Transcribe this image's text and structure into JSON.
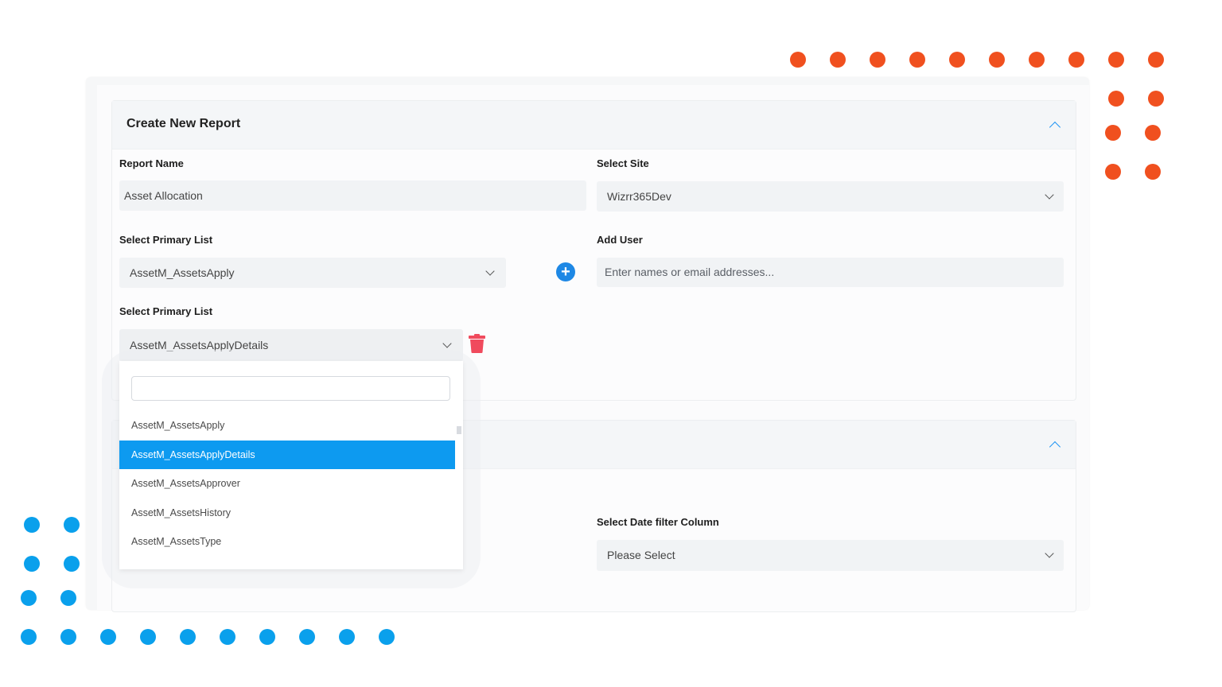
{
  "colors": {
    "decor_orange": "#f0501f",
    "decor_blue": "#0aa0ec",
    "accent": "#0d9af0",
    "delete": "#f04a5d"
  },
  "report": {
    "title": "Create New Report",
    "report_name_label": "Report Name",
    "report_name_value": "Asset Allocation",
    "site_label": "Select Site",
    "site_value": "Wizrr365Dev",
    "primary_list_label": "Select Primary List",
    "primary_list_value": "AssetM_AssetsApply",
    "add_user_label": "Add User",
    "add_user_placeholder": "Enter names or email addresses...",
    "secondary_list_label": "Select Primary List",
    "secondary_list_value": "AssetM_AssetsApplyDetails",
    "add_icon": "plus-circle-icon",
    "delete_icon": "trash-icon"
  },
  "dropdown": {
    "search_value": "",
    "items": [
      {
        "label": "AssetM_AssetsApply",
        "selected": false
      },
      {
        "label": "AssetM_AssetsApplyDetails",
        "selected": true
      },
      {
        "label": "AssetM_AssetsApprover",
        "selected": false
      },
      {
        "label": "AssetM_AssetsHistory",
        "selected": false
      },
      {
        "label": "AssetM_AssetsType",
        "selected": false
      }
    ]
  },
  "section2": {
    "date_filter_label": "Select Date filter Column",
    "date_filter_value": "Please Select"
  }
}
